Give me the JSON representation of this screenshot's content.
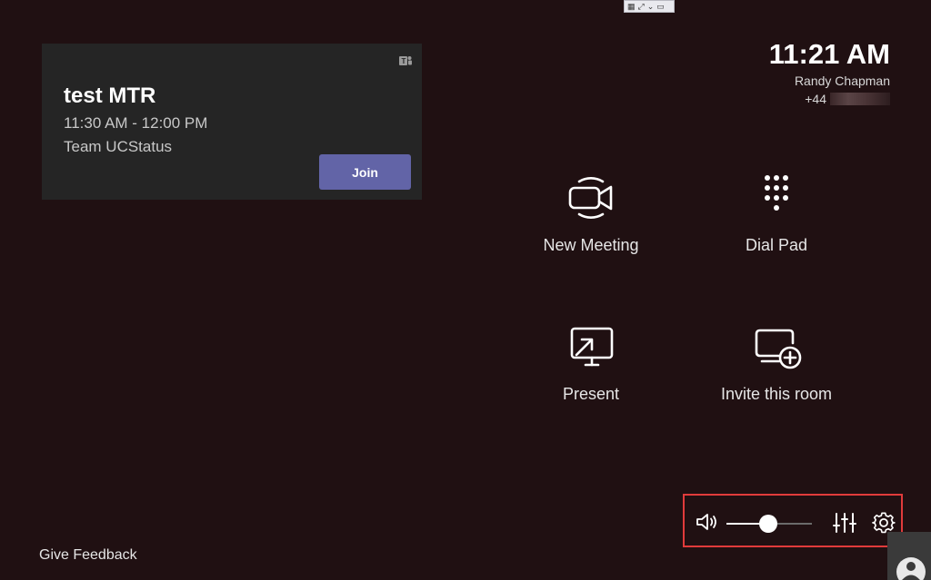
{
  "window_toolbar": {
    "items": [
      "▦",
      "⤢",
      "⌄",
      "▭"
    ]
  },
  "meeting": {
    "title": "test MTR",
    "time": "11:30 AM - 12:00 PM",
    "organizer": "Team UCStatus",
    "join_label": "Join",
    "teams_icon": "teams-icon"
  },
  "header": {
    "clock": "11:21 AM",
    "user_name": "Randy Chapman",
    "phone_prefix": "+44"
  },
  "actions": [
    {
      "label": "New Meeting",
      "icon": "video-camera-icon"
    },
    {
      "label": "Dial Pad",
      "icon": "dial-pad-icon"
    },
    {
      "label": "Present",
      "icon": "present-screen-icon"
    },
    {
      "label": "Invite this room",
      "icon": "invite-room-icon"
    }
  ],
  "controls": {
    "volume_level": 0.49,
    "speaker_icon": "speaker-icon",
    "equalizer_icon": "equalizer-icon",
    "settings_icon": "gear-icon"
  },
  "footer": {
    "feedback_label": "Give Feedback"
  },
  "colors": {
    "background": "#201012",
    "card": "#252525",
    "join_button": "#6264a7",
    "highlight_box": "#e03b3b"
  }
}
